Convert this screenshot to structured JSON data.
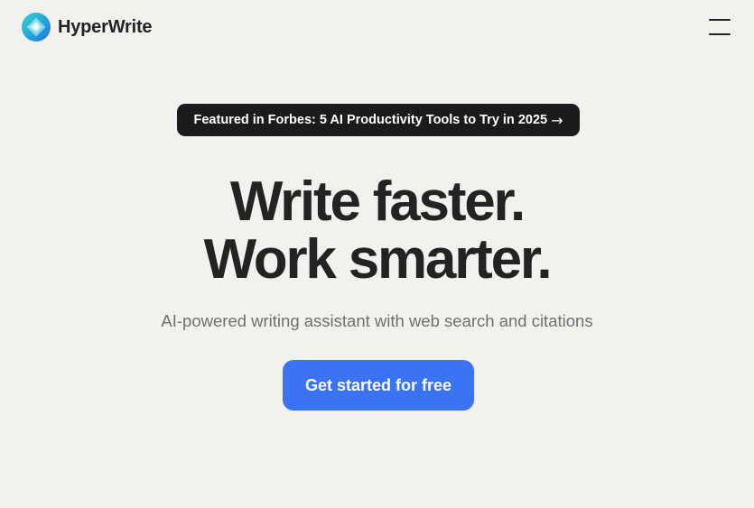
{
  "header": {
    "brand_name": "HyperWrite",
    "logo_icon": "hyperwrite-diamond-logo-icon",
    "menu_icon": "hamburger-menu-icon"
  },
  "hero": {
    "badge_text": "Featured in Forbes: 5 AI Productivity Tools to Try in 2025",
    "badge_arrow": "→",
    "headline_line1": "Write faster.",
    "headline_line2": "Work smarter.",
    "subtitle": "AI-powered writing assistant with web search and citations",
    "cta_label": "Get started for free"
  },
  "colors": {
    "background": "#f2f1ee",
    "badge_bg": "#1a1b1d",
    "cta_bg": "#3b73f5",
    "headline": "#232323",
    "subtitle": "#707070"
  }
}
